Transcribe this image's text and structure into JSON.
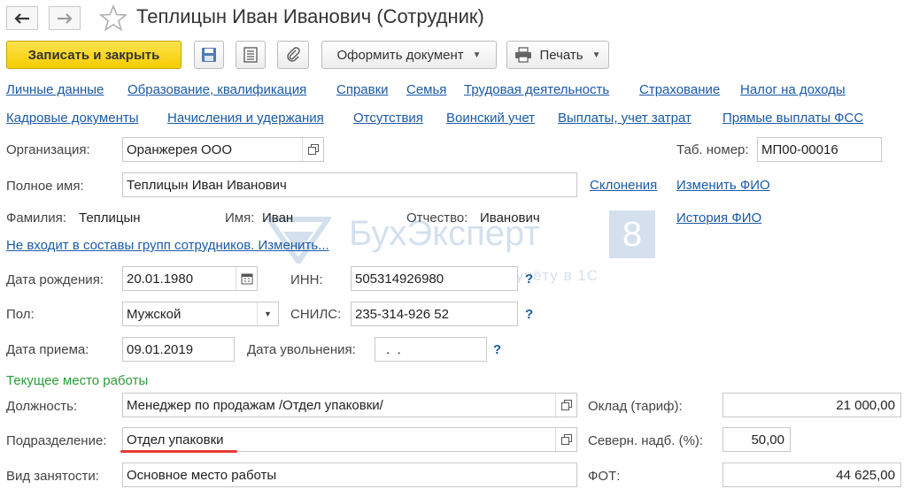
{
  "window": {
    "title": "Теплицын Иван Иванович (Сотрудник)"
  },
  "toolbar": {
    "save_close": "Записать и закрыть",
    "create_doc": "Оформить документ",
    "print": "Печать"
  },
  "tabs_row1": [
    "Личные данные",
    "Образование, квалификация",
    "Справки",
    "Семья",
    "Трудовая деятельность",
    "Страхование",
    "Налог на доходы"
  ],
  "tabs_row2": [
    "Кадровые документы",
    "Начисления и удержания",
    "Отсутствия",
    "Воинский учет",
    "Выплаты, учет затрат",
    "Прямые выплаты ФСС"
  ],
  "form": {
    "org_label": "Организация:",
    "org_value": "Оранжерея ООО",
    "tabnum_label": "Таб. номер:",
    "tabnum_value": "МП00-00016",
    "fullname_label": "Полное имя:",
    "fullname_value": "Теплицын Иван Иванович",
    "declension_link": "Склонения",
    "change_fio_link": "Изменить ФИО",
    "history_fio_link": "История ФИО",
    "surname_label": "Фамилия:",
    "surname_value": "Теплицын",
    "name_label": "Имя:",
    "name_value": "Иван",
    "patronymic_label": "Отчество:",
    "patronymic_value": "Иванович",
    "groups_link": "Не входит в составы групп сотрудников. Изменить...",
    "birth_label": "Дата рождения:",
    "birth_value": "20.01.1980",
    "inn_label": "ИНН:",
    "inn_value": "505314926980",
    "sex_label": "Пол:",
    "sex_value": "Мужской",
    "snils_label": "СНИЛС:",
    "snils_value": "235-314-926 52",
    "hire_label": "Дата приема:",
    "hire_value": "09.01.2019",
    "dismiss_label": "Дата увольнения:",
    "dismiss_value": " .  .",
    "help_mark": "?",
    "current_work_title": "Текущее место работы",
    "position_label": "Должность:",
    "position_value": "Менеджер по продажам /Отдел упаковки/",
    "salary_label": "Оклад (тариф):",
    "salary_value": "21 000,00",
    "dept_label": "Подразделение:",
    "dept_value": "Отдел упаковки",
    "north_label": "Северн. надб. (%):",
    "north_value": "50,00",
    "employment_label": "Вид занятости:",
    "employment_value": "Основное место работы",
    "fot_label": "ФОТ:",
    "fot_value": "44 625,00"
  },
  "watermark": {
    "brand": "БухЭксперт",
    "digit": "8",
    "tagline": "ов по учёту в 1С"
  },
  "colors": {
    "accent_yellow": "#f5cc00",
    "link_blue": "#1a5aa6",
    "section_green": "#2a9c3a",
    "underline_red": "#e53935"
  }
}
